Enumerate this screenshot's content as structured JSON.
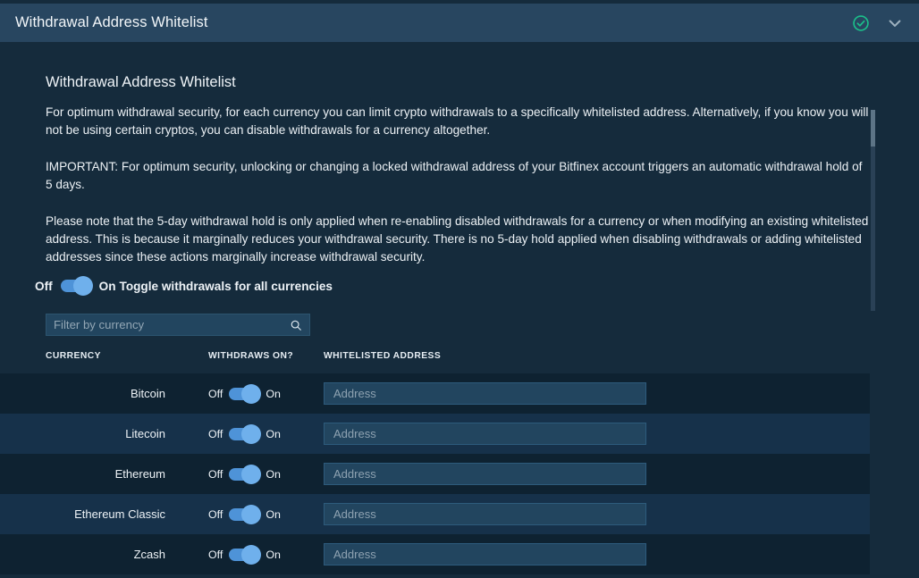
{
  "header": {
    "title": "Withdrawal Address Whitelist",
    "status_icon": "check-circle-icon",
    "collapse_icon": "chevron-down-icon",
    "accent_color": "#1bbf8a",
    "bar_color": "#284660"
  },
  "main": {
    "section_title": "Withdrawal Address Whitelist",
    "paragraphs": [
      "For optimum withdrawal security, for each currency you can limit crypto withdrawals to a specifically whitelisted address. Alternatively, if you know you will not be using certain cryptos, you can disable withdrawals for a currency altogether.",
      "IMPORTANT: For optimum security, unlocking or changing a locked withdrawal address of your Bitfinex account triggers an automatic withdrawal hold of 5 days.",
      "Please note that the 5-day withdrawal hold is only applied when re-enabling disabled withdrawals for a currency or when modifying an existing whitelisted address. This is because it marginally reduces your withdrawal security. There is no 5-day hold applied when disabling withdrawals or adding whitelisted addresses since these actions marginally increase withdrawal security."
    ]
  },
  "global_toggle": {
    "off_label": "Off",
    "on_label": "On",
    "description": "Toggle withdrawals for all currencies",
    "state": "on",
    "track_color": "#4e93d8",
    "knob_color": "#6fb0ec"
  },
  "filter": {
    "placeholder": "Filter by currency",
    "value": "",
    "icon": "search-icon"
  },
  "table": {
    "columns": {
      "currency": "CURRENCY",
      "withdraws_on": "WITHDRAWS ON?",
      "whitelisted_address": "WHITELISTED ADDRESS"
    },
    "toggle_off_label": "Off",
    "toggle_on_label": "On",
    "address_placeholder": "Address",
    "rows": [
      {
        "currency": "Bitcoin",
        "withdraws_on": "on",
        "address": ""
      },
      {
        "currency": "Litecoin",
        "withdraws_on": "on",
        "address": ""
      },
      {
        "currency": "Ethereum",
        "withdraws_on": "on",
        "address": ""
      },
      {
        "currency": "Ethereum Classic",
        "withdraws_on": "on",
        "address": ""
      },
      {
        "currency": "Zcash",
        "withdraws_on": "on",
        "address": ""
      }
    ]
  },
  "scrollbar": {
    "orientation": "vertical",
    "thumb_position": "top"
  }
}
